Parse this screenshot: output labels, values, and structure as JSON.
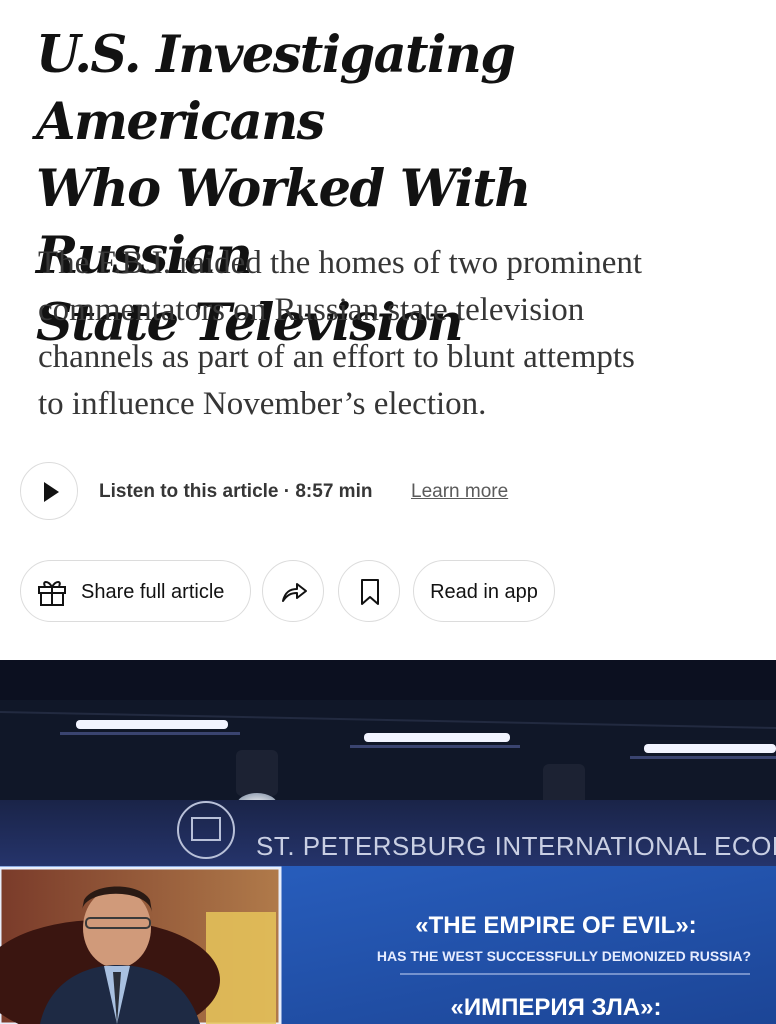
{
  "article": {
    "headline_lines": [
      "U.S. Investigating Americans",
      "Who Worked With Russian",
      "State Television"
    ],
    "summary_lines": [
      "The F.B.I. raided the homes of two prominent",
      "commentators on Russian state television",
      "channels as part of an effort to blunt attempts",
      "to influence November’s election."
    ]
  },
  "audio": {
    "listen_label": "Listen to this article · 8:57 min",
    "learn_more": "Learn more"
  },
  "actions": {
    "share_label": "Share full article",
    "read_in_app": "Read in app"
  },
  "photo": {
    "banner_text": "ST. PETERSBURG INTERNATIONAL ECON",
    "screen_title": "«THE EMPIRE OF EVIL»:",
    "screen_subtitle": "HAS THE WEST SUCCESSFULLY DEMONIZED RUSSIA?",
    "screen_title_ru": "«ИМПЕРИЯ ЗЛА»:"
  },
  "icons": {
    "play": "play-icon",
    "gift": "gift-icon",
    "forward": "share-arrow-icon",
    "bookmark": "bookmark-icon"
  },
  "colors": {
    "text": "#121212",
    "summary_text": "#363636",
    "border": "#dcdcdc",
    "screen_blue": "#1f4fa8"
  }
}
